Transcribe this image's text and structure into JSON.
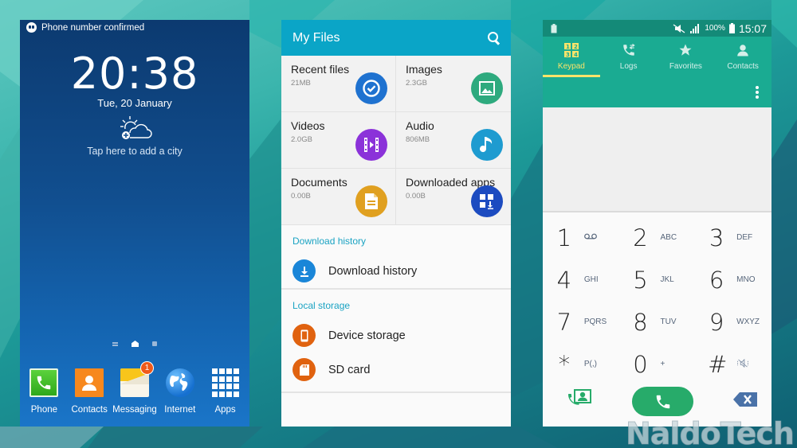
{
  "lock_screen": {
    "notification": "Phone number confirmed",
    "time": "20:38",
    "date": "Tue, 20 January",
    "weather_prompt": "Tap here to add a city",
    "dock": [
      {
        "label": "Phone",
        "icon": "phone-icon"
      },
      {
        "label": "Contacts",
        "icon": "contacts-icon"
      },
      {
        "label": "Messaging",
        "icon": "messaging-icon",
        "badge": "1"
      },
      {
        "label": "Internet",
        "icon": "globe-icon"
      },
      {
        "label": "Apps",
        "icon": "apps-grid-icon"
      }
    ]
  },
  "my_files": {
    "title": "My Files",
    "categories": [
      {
        "name": "Recent files",
        "size": "21MB",
        "icon": "clock-check-icon",
        "color": "#1f72d0"
      },
      {
        "name": "Images",
        "size": "2.3GB",
        "icon": "image-icon",
        "color": "#2eaa7e"
      },
      {
        "name": "Videos",
        "size": "2.0GB",
        "icon": "video-icon",
        "color": "#8b32d9"
      },
      {
        "name": "Audio",
        "size": "806MB",
        "icon": "music-note-icon",
        "color": "#1e9bd0"
      },
      {
        "name": "Documents",
        "size": "0.00B",
        "icon": "document-icon",
        "color": "#e0a020"
      },
      {
        "name": "Downloaded apps",
        "size": "0.00B",
        "icon": "download-apps-icon",
        "color": "#1c4bc0"
      }
    ],
    "sections": [
      {
        "header": "Download history",
        "items": [
          {
            "label": "Download history",
            "icon": "download-icon",
            "color": "#1a86d8"
          }
        ]
      },
      {
        "header": "Local storage",
        "items": [
          {
            "label": "Device storage",
            "icon": "device-icon",
            "color": "#e0620f"
          },
          {
            "label": "SD card",
            "icon": "sd-card-icon",
            "color": "#e0620f"
          }
        ]
      }
    ]
  },
  "dialer": {
    "status_bar": {
      "battery": "100%",
      "time": "15:07"
    },
    "tabs": [
      {
        "label": "Keypad",
        "active": true
      },
      {
        "label": "Logs",
        "active": false
      },
      {
        "label": "Favorites",
        "active": false
      },
      {
        "label": "Contacts",
        "active": false
      }
    ],
    "keys": [
      {
        "digit": "1",
        "letters": "voicemail"
      },
      {
        "digit": "2",
        "letters": "ABC"
      },
      {
        "digit": "3",
        "letters": "DEF"
      },
      {
        "digit": "4",
        "letters": "GHI"
      },
      {
        "digit": "5",
        "letters": "JKL"
      },
      {
        "digit": "6",
        "letters": "MNO"
      },
      {
        "digit": "7",
        "letters": "PQRS"
      },
      {
        "digit": "8",
        "letters": "TUV"
      },
      {
        "digit": "9",
        "letters": "WXYZ"
      },
      {
        "digit": "*",
        "letters": "P(,)"
      },
      {
        "digit": "0",
        "letters": "+"
      },
      {
        "digit": "#",
        "letters": "mute"
      }
    ]
  },
  "watermark": "NaldoTech",
  "colors": {
    "files_accent": "#0aa5c7",
    "dialer_accent": "#1aab92",
    "dialer_active_tab": "#f8e36a",
    "call_button": "#27ab6a"
  }
}
